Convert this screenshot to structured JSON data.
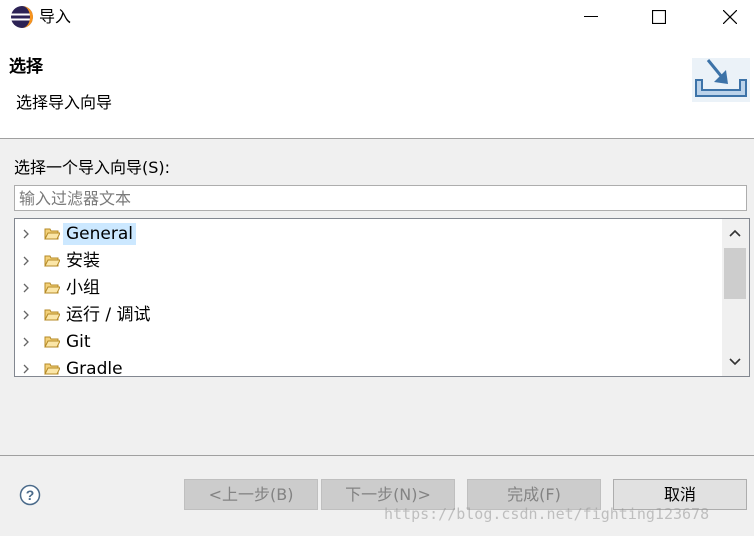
{
  "window": {
    "title": "导入",
    "controls": {
      "minimize_icon": "minimize-icon",
      "maximize_icon": "maximize-icon",
      "close_icon": "close-icon"
    }
  },
  "header": {
    "title": "选择",
    "description": "选择导入向导",
    "icon": "import-wizard-icon"
  },
  "wizard_list": {
    "label": "选择一个导入向导(S):",
    "filter": {
      "value": "",
      "placeholder": "输入过滤器文本"
    },
    "items": [
      {
        "label": "General",
        "selected": true,
        "icon": "folder-icon"
      },
      {
        "label": "安装",
        "selected": false,
        "icon": "folder-icon"
      },
      {
        "label": "小组",
        "selected": false,
        "icon": "folder-icon"
      },
      {
        "label": "运行 / 调试",
        "selected": false,
        "icon": "folder-icon"
      },
      {
        "label": "Git",
        "selected": false,
        "icon": "folder-icon"
      },
      {
        "label": "Gradle",
        "selected": false,
        "icon": "folder-icon"
      }
    ]
  },
  "footer": {
    "help_icon": "help-icon",
    "buttons": {
      "back": "<上一步(B)",
      "next": "下一步(N)>",
      "finish": "完成(F)",
      "cancel": "取消"
    }
  },
  "watermark": "https://blog.csdn.net/fighting123678",
  "colors": {
    "selection": "#cce8ff",
    "disabled_button": "#cccccc",
    "dialog_background": "#f0f0f0"
  }
}
